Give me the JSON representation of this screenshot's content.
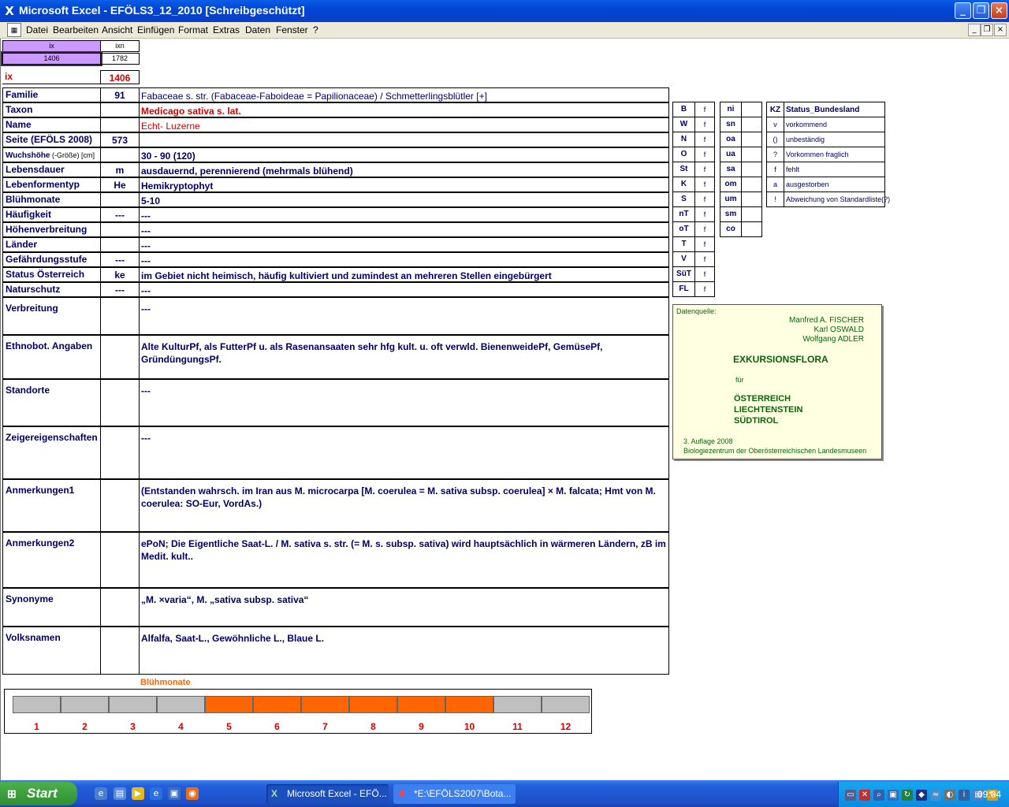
{
  "window": {
    "title": "Microsoft Excel - EFÖLS3_12_2010  [Schreibgeschützt]",
    "minimize": "_",
    "restore": "❐",
    "close": "×"
  },
  "menu": {
    "items": [
      "Datei",
      "Bearbeiten",
      "Ansicht",
      "Einfügen",
      "Format",
      "Extras",
      "Daten",
      "Fenster",
      "?"
    ]
  },
  "topcells": {
    "ix_head": "ix",
    "ixn_head": "ixn",
    "ix_val": "1406",
    "ixn_val": "1782",
    "ix_label": "ix",
    "ix_big": "1406"
  },
  "rows": [
    {
      "label": "Familie",
      "code": "91",
      "value": "Fabaceae s. str. (Fabaceae-Faboideae = Papilionaceae)  /  Schmetterlingsblütler [+]"
    },
    {
      "label": "Taxon",
      "code": "",
      "value": "Medicago sativa s. lat."
    },
    {
      "label": "Name",
      "code": "",
      "value": "Echt- Luzerne"
    },
    {
      "label": "Seite (EFÖLS 2008)",
      "code": "573",
      "value": ""
    },
    {
      "label": "Wuchshöhe",
      "label_small": " (-Größe) [cm]",
      "code": "",
      "value": " 30 - 90 (120)"
    },
    {
      "label": "Lebensdauer",
      "code": "m",
      "value": "ausdauernd, perennierend (mehrmals blühend)"
    },
    {
      "label": "Lebenformentyp",
      "code": "He",
      "value": "Hemikryptophyt"
    },
    {
      "label": "Blühmonate",
      "code": "",
      "value": " 5-10"
    },
    {
      "label": "Häufigkeit",
      "code": "---",
      "value": " ---"
    },
    {
      "label": "Höhenverbreitung",
      "code": "",
      "value": " ---"
    },
    {
      "label": "Länder",
      "code": "",
      "value": " ---"
    },
    {
      "label": "Gefährdungsstufe",
      "code": "---",
      "value": "   ---"
    },
    {
      "label": "Status Österreich",
      "code": "ke",
      "value": "im Gebiet nicht heimisch, häufig kultiviert und zumindest an mehreren Stellen eingebürgert"
    },
    {
      "label": "Naturschutz",
      "code": "---",
      "value": " ---"
    },
    {
      "label": "Verbreitung",
      "code": "",
      "value": " ---"
    },
    {
      "label": "Ethnobot. Angaben",
      "code": "",
      "value": "Alte KulturPf, als FutterPf u. als Rasenansaaten sehr hfg kult. u. oft verwld. BienenweidePf, GemüsePf, GründüngungsPf."
    },
    {
      "label": "Standorte",
      "code": "",
      "value": "---"
    },
    {
      "label": "Zeigereigenschaften",
      "code": "",
      "value": "---"
    },
    {
      "label": "Anmerkungen1",
      "code": "",
      "value": "(Entstanden wahrsch. im Iran aus M. microcarpa [M. coerulea = M. sativa subsp. coerulea] × M. falcata; Hmt von M. coerulea: SO-Eur, VordAs.)"
    },
    {
      "label": "Anmerkungen2",
      "code": "",
      "value": "ePoN; Die Eigentliche Saat-L. / M. sativa s. str. (= M. s. subsp. sativa) wird hauptsächlich in wärmeren Ländern, zB im Medit. kult.."
    },
    {
      "label": "Synonyme",
      "code": "",
      "value": "„M. ×varia“, M. „sativa subsp. sativa“"
    },
    {
      "label": "Volksnamen",
      "code": "",
      "value": "Alfalfa, Saat-L., Gewöhnliche L., Blaue L."
    }
  ],
  "states": [
    {
      "k": "B",
      "v": "f"
    },
    {
      "k": "W",
      "v": "f"
    },
    {
      "k": "N",
      "v": "f"
    },
    {
      "k": "O",
      "v": "f"
    },
    {
      "k": "St",
      "v": "f"
    },
    {
      "k": "K",
      "v": "f"
    },
    {
      "k": "S",
      "v": "f"
    },
    {
      "k": "nT",
      "v": "f"
    },
    {
      "k": "oT",
      "v": "f"
    },
    {
      "k": "T",
      "v": "f"
    },
    {
      "k": "V",
      "v": "f"
    },
    {
      "k": "SüT",
      "v": "f"
    },
    {
      "k": "FL",
      "v": "f"
    }
  ],
  "regions": [
    "ni",
    "sn",
    "oa",
    "ua",
    "sa",
    "om",
    "um",
    "sm",
    "co"
  ],
  "legend": {
    "head_k": "KZ",
    "head_v": "Status_Bundesland",
    "items": [
      {
        "k": "v",
        "v": "vorkommend"
      },
      {
        "k": "()",
        "v": "unbeständig"
      },
      {
        "k": "?",
        "v": "Vorkommen fraglich"
      },
      {
        "k": "f",
        "v": "fehlt"
      },
      {
        "k": "a",
        "v": "ausgestorben"
      },
      {
        "k": "!",
        "v": "Abweichung von Standardliste(?)"
      }
    ]
  },
  "source": {
    "label": "Datenquelle:",
    "a1": "Manfred A. FISCHER",
    "a2": "Karl OSWALD",
    "a3": "Wolfgang ADLER",
    "title": "EXKURSIONSFLORA",
    "fuer": "für",
    "c1": "ÖSTERREICH",
    "c2": "LIECHTENSTEIN",
    "c3": "SÜDTIROL",
    "ed": "3. Auflage 2008",
    "pub": "Biologiezentrum der Oberösterreichischen Landesmuseen"
  },
  "bloom": {
    "title": "Blühmonate",
    "months": [
      "1",
      "2",
      "3",
      "4",
      "5",
      "6",
      "7",
      "8",
      "9",
      "10",
      "11",
      "12"
    ],
    "active": [
      false,
      false,
      false,
      false,
      true,
      true,
      true,
      true,
      true,
      true,
      false,
      false
    ],
    "active_color": "#ff6600",
    "inactive_color": "#c0c0c0"
  },
  "taskbar": {
    "start": "Start",
    "tasks": [
      "Microsoft Excel - EFÖ...",
      "*E:\\EFÖLS2007\\Bota..."
    ],
    "clock": "09:04"
  }
}
